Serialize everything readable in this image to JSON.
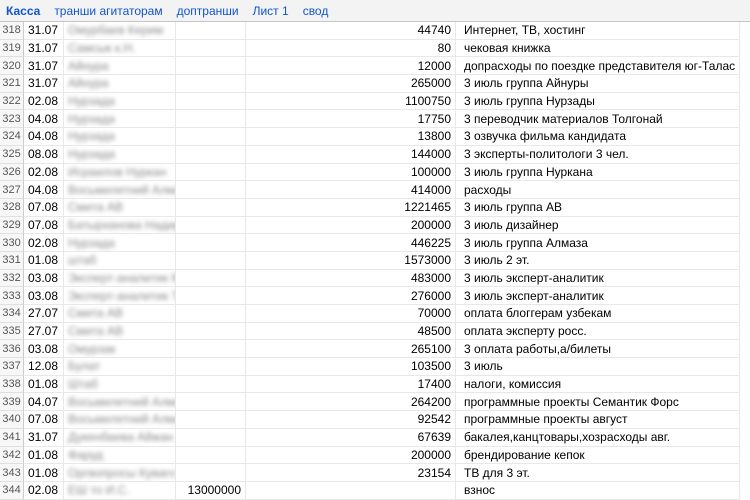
{
  "tabs": [
    {
      "label": "Касса",
      "active": true
    },
    {
      "label": "транши агитаторам",
      "active": false
    },
    {
      "label": "доптранши",
      "active": false
    },
    {
      "label": "Лист 1",
      "active": false
    },
    {
      "label": "свод",
      "active": false
    }
  ],
  "rows": [
    {
      "num": "318",
      "date": "31.07",
      "name": "Омурбаев Керим",
      "amt1": "",
      "amt2": "44740",
      "desc": "Интернет, ТВ, хостинг"
    },
    {
      "num": "319",
      "date": "31.07",
      "name": "Самсык к.Н.",
      "amt1": "",
      "amt2": "80",
      "desc": "чековая книжка"
    },
    {
      "num": "320",
      "date": "31.07",
      "name": "Айнура",
      "amt1": "",
      "amt2": "12000",
      "desc": "допрасходы по поездке представителя юг-Талас"
    },
    {
      "num": "321",
      "date": "31.07",
      "name": "Айнура",
      "amt1": "",
      "amt2": "265000",
      "desc": "3 июль группа Айнуры"
    },
    {
      "num": "322",
      "date": "02.08",
      "name": "Нурзада",
      "amt1": "",
      "amt2": "1100750",
      "desc": "3 июль группа Нурзады"
    },
    {
      "num": "323",
      "date": "04.08",
      "name": "Нурзада",
      "amt1": "",
      "amt2": "17750",
      "desc": "3 переводчик материалов Толгонай"
    },
    {
      "num": "324",
      "date": "04.08",
      "name": "Нурзада",
      "amt1": "",
      "amt2": "13800",
      "desc": "3 озвучка фильма кандидата"
    },
    {
      "num": "325",
      "date": "08.08",
      "name": "Нурзада",
      "amt1": "",
      "amt2": "144000",
      "desc": "3 эксперты-политологи 3 чел."
    },
    {
      "num": "326",
      "date": "02.08",
      "name": "Исраилов Нуркан",
      "amt1": "",
      "amt2": "100000",
      "desc": "3 июль группа Нуркана"
    },
    {
      "num": "327",
      "date": "04.08",
      "name": "Восьмилетний Алмаз",
      "amt1": "",
      "amt2": "414000",
      "desc": "расходы"
    },
    {
      "num": "328",
      "date": "07.08",
      "name": "Смита АВ",
      "amt1": "",
      "amt2": "1221465",
      "desc": "3 июль группа АВ"
    },
    {
      "num": "329",
      "date": "07.08",
      "name": "Батырханова Надир",
      "amt1": "",
      "amt2": "200000",
      "desc": "3 июль дизайнер"
    },
    {
      "num": "330",
      "date": "02.08",
      "name": "Нурзада",
      "amt1": "",
      "amt2": "446225",
      "desc": "3 июль группа Алмаза"
    },
    {
      "num": "331",
      "date": "01.08",
      "name": "штаб",
      "amt1": "",
      "amt2": "1573000",
      "desc": "3 июль 2 эт."
    },
    {
      "num": "332",
      "date": "03.08",
      "name": "Эксперт-аналитик ММ",
      "amt1": "",
      "amt2": "483000",
      "desc": "3 июль эксперт-аналитик"
    },
    {
      "num": "333",
      "date": "03.08",
      "name": "Эксперт-аналитик ТФ",
      "amt1": "",
      "amt2": "276000",
      "desc": "3 июль эксперт-аналитик"
    },
    {
      "num": "334",
      "date": "27.07",
      "name": "Смита АВ",
      "amt1": "",
      "amt2": "70000",
      "desc": "оплата блоггерам узбекам"
    },
    {
      "num": "335",
      "date": "27.07",
      "name": "Смита АВ",
      "amt1": "",
      "amt2": "48500",
      "desc": "оплата эксперту росс."
    },
    {
      "num": "336",
      "date": "03.08",
      "name": "Омурзак",
      "amt1": "",
      "amt2": "265100",
      "desc": "3 оплата работы,а/билеты"
    },
    {
      "num": "337",
      "date": "12.08",
      "name": "Булат",
      "amt1": "",
      "amt2": "103500",
      "desc": "3 июль"
    },
    {
      "num": "338",
      "date": "01.08",
      "name": "Штаб",
      "amt1": "",
      "amt2": "17400",
      "desc": "налоги, комиссия"
    },
    {
      "num": "339",
      "date": "04.07",
      "name": "Восьмилетний Алмаз",
      "amt1": "",
      "amt2": "264200",
      "desc": "программные проекты Семантик Форс"
    },
    {
      "num": "340",
      "date": "07.08",
      "name": "Восьмилетний Алмаз",
      "amt1": "",
      "amt2": "92542",
      "desc": "программные проекты август"
    },
    {
      "num": "341",
      "date": "31.07",
      "name": "Дукенбаева Айжан",
      "amt1": "",
      "amt2": "67639",
      "desc": "бакалея,канцтовары,хозрасходы авг."
    },
    {
      "num": "342",
      "date": "01.08",
      "name": "Фаруд",
      "amt1": "",
      "amt2": "200000",
      "desc": "брендирование кепок"
    },
    {
      "num": "343",
      "date": "01.08",
      "name": "Оргвопросы Куваго",
      "amt1": "",
      "amt2": "23154",
      "desc": "ТВ для 3 эт."
    },
    {
      "num": "344",
      "date": "02.08",
      "name": "ЕШ то И.С.",
      "amt1": "13000000",
      "amt2": "",
      "desc": "взнос"
    }
  ]
}
